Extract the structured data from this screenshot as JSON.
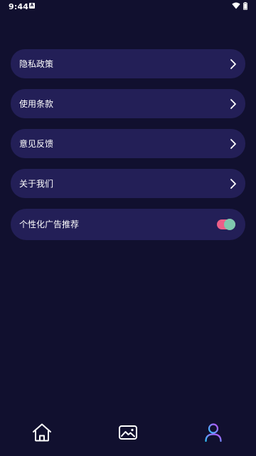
{
  "status_bar": {
    "time": "9:44",
    "notification_icon": "a-icon",
    "a_icon_text": "A",
    "wifi_icon": "wifi-icon",
    "battery_icon": "battery-icon"
  },
  "menu": {
    "items": [
      {
        "label": "隐私政策",
        "action_icon": "chevron-right-icon"
      },
      {
        "label": "使用条款",
        "action_icon": "chevron-right-icon"
      },
      {
        "label": "意见反馈",
        "action_icon": "chevron-right-icon"
      },
      {
        "label": "关于我们",
        "action_icon": "chevron-right-icon"
      }
    ],
    "toggle_item": {
      "label": "个性化广告推荐",
      "checked": true
    }
  },
  "bottom_nav": {
    "tabs": [
      {
        "name": "home",
        "icon": "home-icon",
        "active": false
      },
      {
        "name": "gallery",
        "icon": "image-icon",
        "active": false
      },
      {
        "name": "profile",
        "icon": "user-icon",
        "active": true
      }
    ]
  },
  "colors": {
    "background": "#11102f",
    "card": "#231f57",
    "toggle_track": "#ec5f88",
    "toggle_knob": "#7fc8ae",
    "profile_gradient_start": "#2ec7ff",
    "profile_gradient_end": "#c04dff"
  }
}
